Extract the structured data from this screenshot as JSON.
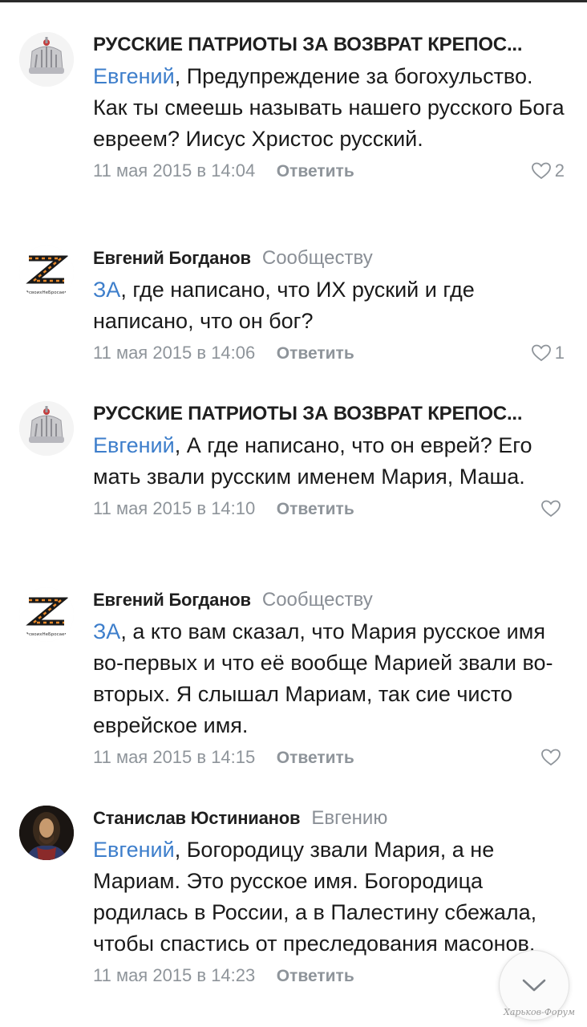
{
  "comments": [
    {
      "author": "РУССКИЕ ПАТРИОТЫ ЗА ВОЗВРАТ КРЕПОС...",
      "reply_to": "",
      "mention": "Евгений",
      "text": ", Предупреждение за богохульство. Как ты смеешь называть нашего русского Бога евреем? Иисус Христос русский.",
      "date": "11 мая 2015 в 14:04",
      "reply_label": "Ответить",
      "likes": "2",
      "avatar_icon": "crown-icon"
    },
    {
      "author": "Евгений Богданов",
      "reply_to": "Сообществу",
      "mention": "ЗА",
      "text": ", где написано, что ИХ руский и где написано, что он бог?",
      "date": "11 мая 2015 в 14:06",
      "reply_label": "Ответить",
      "likes": "1",
      "avatar_icon": "z-ribbon-icon",
      "avatar_caption": "#своихНеБросаем"
    },
    {
      "author": "РУССКИЕ ПАТРИОТЫ ЗА ВОЗВРАТ КРЕПОС...",
      "reply_to": "",
      "mention": "Евгений",
      "text": ", А где написано, что он еврей? Его мать звали русским именем Мария, Маша.",
      "date": "11 мая 2015 в 14:10",
      "reply_label": "Ответить",
      "likes": "",
      "avatar_icon": "crown-icon"
    },
    {
      "author": "Евгений Богданов",
      "reply_to": "Сообществу",
      "mention": "ЗА",
      "text": ", а кто вам сказал, что Мария русское имя во-первых и что её вообще Марией звали во-вторых. Я слышал Мариам, так сие чисто еврейское имя.",
      "date": "11 мая 2015 в 14:15",
      "reply_label": "Ответить",
      "likes": "",
      "avatar_icon": "z-ribbon-icon",
      "avatar_caption": "#своихНеБросаем"
    },
    {
      "author": "Станислав Юстинианов",
      "reply_to": "Евгению",
      "mention": "Евгений",
      "text": ", Богородицу звали Мария, а не Мариам. Это русское имя. Богородица родилась в России, а в Палестину сбежала, чтобы спастись от преследования масонов.",
      "date": "11 мая 2015 в 14:23",
      "reply_label": "Ответить",
      "likes": "",
      "avatar_icon": "portrait-icon"
    }
  ],
  "watermark": "Харьков-Форум",
  "colors": {
    "mention": "#3d7ecb",
    "meta": "#8e949a",
    "ribbon_orange": "#e8892b"
  }
}
